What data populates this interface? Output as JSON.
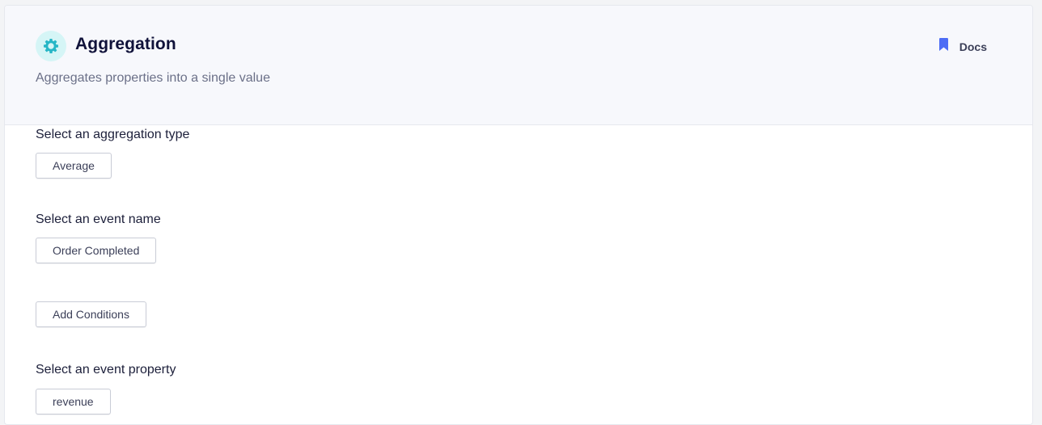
{
  "header": {
    "title": "Aggregation",
    "subtitle": "Aggregates properties into a single value",
    "docs_label": "Docs",
    "title_icon": "gear-icon",
    "docs_icon": "bookmark-icon"
  },
  "colors": {
    "accent_teal": "#26b6c6",
    "accent_blue": "#4d6df5",
    "icon_bg": "#d5f5f6"
  },
  "form": {
    "aggregation_type": {
      "label": "Select an aggregation type",
      "value": "Average"
    },
    "event_name": {
      "label": "Select an event name",
      "value": "Order Completed"
    },
    "add_conditions_label": "Add Conditions",
    "event_property": {
      "label": "Select an event property",
      "value": "revenue"
    }
  }
}
